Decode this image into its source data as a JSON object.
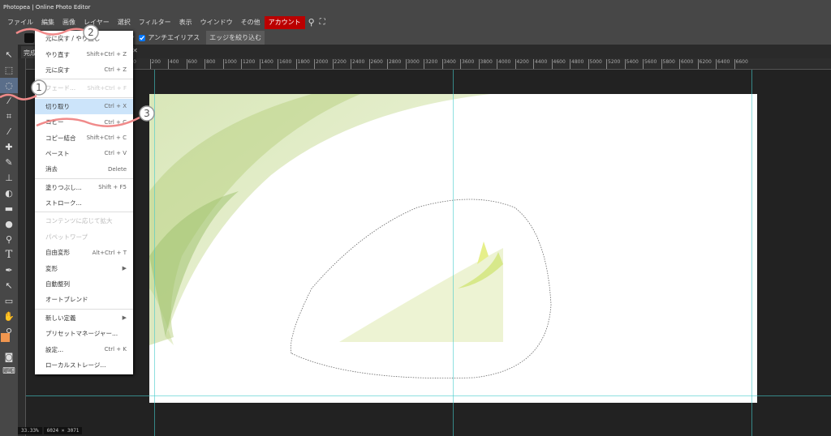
{
  "title": "Photopea | Online Photo Editor",
  "menubar": [
    "ファイル",
    "編集",
    "画像",
    "レイヤー",
    "選択",
    "フィルター",
    "表示",
    "ウインドウ",
    "その他",
    "アカウント"
  ],
  "options": {
    "antialias_label": "アンチエイリアス",
    "antialias_checked": true,
    "refine_edge_label": "エッジを絞り込む"
  },
  "tab": {
    "label": "完成"
  },
  "ruler_labels": [
    "200",
    "0",
    "200",
    "400",
    "600",
    "800",
    "1000",
    "1200",
    "1400",
    "1600",
    "1800",
    "2000",
    "2200",
    "2400",
    "2600",
    "2800",
    "3000",
    "3200",
    "3400",
    "3600",
    "3800",
    "4000",
    "4200",
    "4400",
    "4600",
    "4800",
    "5000",
    "5200",
    "5400",
    "5600",
    "5800",
    "6000",
    "6200",
    "6400",
    "6600"
  ],
  "edit_menu": [
    {
      "label": "元に戻す / やり直し",
      "shortcut": ""
    },
    {
      "label": "やり直す",
      "shortcut": "Shift+Ctrl + Z"
    },
    {
      "label": "元に戻す",
      "shortcut": "Ctrl + Z"
    },
    "sep",
    {
      "label": "フェード...",
      "shortcut": "Shift+Ctrl + F",
      "disabled": true
    },
    "sep",
    {
      "label": "切り取り",
      "shortcut": "Ctrl + X",
      "highlight": true
    },
    {
      "label": "コピー",
      "shortcut": "Ctrl + C"
    },
    {
      "label": "コピー結合",
      "shortcut": "Shift+Ctrl + C"
    },
    {
      "label": "ペースト",
      "shortcut": "Ctrl + V"
    },
    {
      "label": "消去",
      "shortcut": "Delete"
    },
    "sep",
    {
      "label": "塗りつぶし...",
      "shortcut": "Shift + F5"
    },
    {
      "label": "ストローク...",
      "shortcut": ""
    },
    "sep",
    {
      "label": "コンテンツに応じて拡大",
      "shortcut": "",
      "disabled": true
    },
    {
      "label": "パペットワープ",
      "shortcut": "",
      "disabled": true
    },
    {
      "label": "自由変形",
      "shortcut": "Alt+Ctrl + T"
    },
    {
      "label": "変形",
      "shortcut": "▶"
    },
    {
      "label": "自動整列",
      "shortcut": ""
    },
    {
      "label": "オートブレンド",
      "shortcut": ""
    },
    "sep",
    {
      "label": "新しい定義",
      "shortcut": "▶"
    },
    {
      "label": "プリセットマネージャー...",
      "shortcut": ""
    },
    {
      "label": "設定...",
      "shortcut": "Ctrl + K"
    },
    {
      "label": "ローカルストレージ...",
      "shortcut": ""
    }
  ],
  "annotations": [
    "1",
    "2",
    "3"
  ],
  "status": {
    "zoom": "33.33%",
    "size": "6024 × 3071"
  },
  "colors": {
    "foreground": "#f0964f",
    "background": "#000000",
    "accent": "#bb0000",
    "annotation": "#f08a8a"
  }
}
